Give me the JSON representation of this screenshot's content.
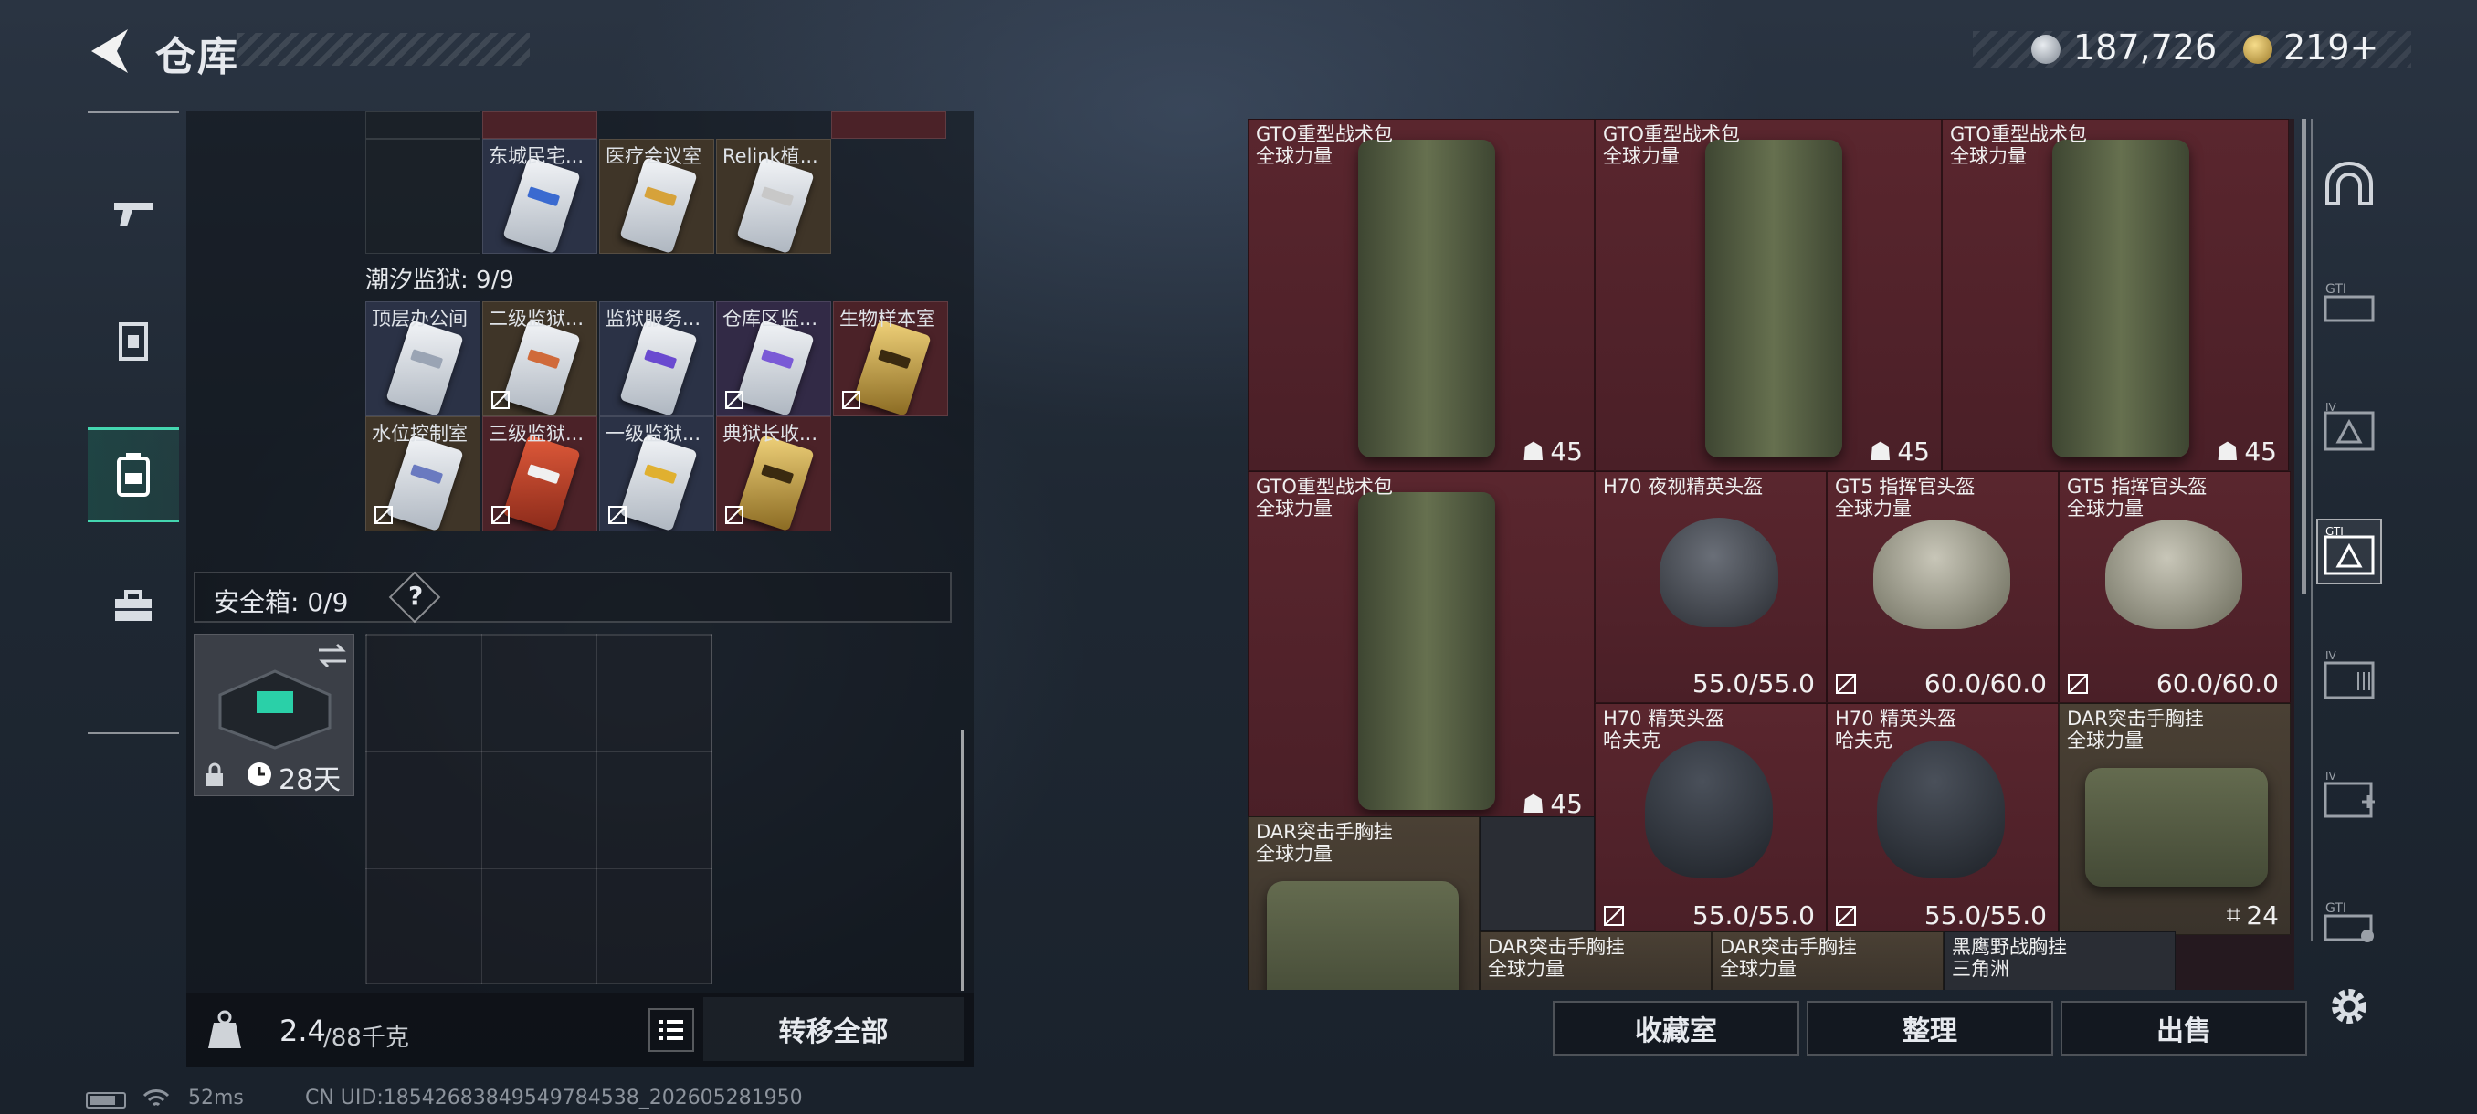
{
  "header": {
    "title": "仓库",
    "currency_1": "187,726",
    "currency_2": "219+"
  },
  "left_nav": [
    "gun-icon",
    "armor-icon",
    "backpack-icon",
    "toolbox-icon"
  ],
  "left_panel": {
    "top_row_labels": [
      "东城民宅...",
      "医疗会议室",
      "Relink植..."
    ],
    "prison_label": "潮汐监狱: 9/9",
    "prison_row1": [
      "顶层办公间",
      "二级监狱...",
      "监狱服务...",
      "仓库区监...",
      "生物样本室"
    ],
    "prison_row2": [
      "水位控制室",
      "三级监狱...",
      "一级监狱...",
      "典狱长收..."
    ],
    "safe_box_label": "安全箱: 0/9",
    "safe_help": "?",
    "safe_timer": "28天",
    "weight_current": "2.4",
    "weight_max": "/88千克",
    "transfer_all": "转移全部"
  },
  "right_panel": {
    "items": [
      {
        "name": "GTO重型战术包",
        "sub": "全球力量",
        "count": "45"
      },
      {
        "name": "GTO重型战术包",
        "sub": "全球力量",
        "count": "45"
      },
      {
        "name": "GTO重型战术包",
        "sub": "全球力量",
        "count": "45"
      },
      {
        "name": "GTO重型战术包",
        "sub": "全球力量",
        "count": "45"
      },
      {
        "name": "H70 夜视精英头盔",
        "sub": "",
        "durability": "55.0/55.0"
      },
      {
        "name": "GT5 指挥官头盔",
        "sub": "全球力量",
        "durability": "60.0/60.0"
      },
      {
        "name": "GT5 指挥官头盔",
        "sub": "全球力量",
        "durability": "60.0/60.0"
      },
      {
        "name": "H70 精英头盔",
        "sub": "哈夫克",
        "durability": "55.0/55.0"
      },
      {
        "name": "H70 精英头盔",
        "sub": "哈夫克",
        "durability": "55.0/55.0"
      },
      {
        "name": "DAR突击手胸挂",
        "sub": "全球力量",
        "count": "24"
      },
      {
        "name": "DAR突击手胸挂",
        "sub": "全球力量"
      },
      {
        "name": "DAR突击手胸挂",
        "sub": "全球力量"
      },
      {
        "name": "DAR突击手胸挂",
        "sub": "全球力量"
      },
      {
        "name": "黑鹰野战胸挂",
        "sub": "三角洲"
      }
    ],
    "buttons": [
      "收藏室",
      "整理",
      "出售"
    ]
  },
  "status": {
    "ping": "52ms",
    "uid": "CN UID:18542683849549784538_202605281950"
  }
}
